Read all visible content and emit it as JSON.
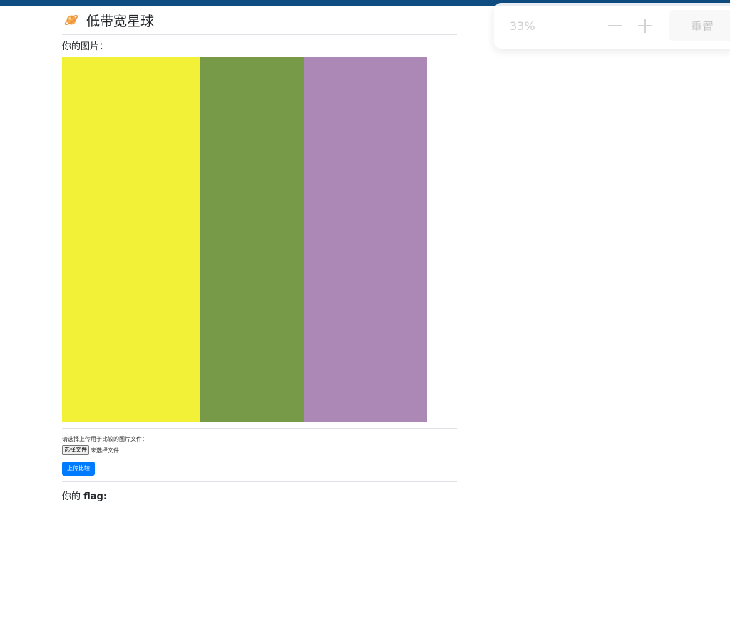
{
  "header": {
    "title": "低带宽星球",
    "icon": "planet-icon"
  },
  "image_section": {
    "label": "你的图片：",
    "stripes": [
      {
        "color": "#f3f137",
        "fraction": 0.379
      },
      {
        "color": "#769a47",
        "fraction": 0.285
      },
      {
        "color": "#ab88b6",
        "fraction": 0.336
      }
    ]
  },
  "upload": {
    "prompt": "请选择上传用于比较的图片文件：",
    "file_button_label": "选择文件",
    "no_file_text": "未选择文件",
    "submit_label": "上传比较"
  },
  "flag": {
    "prefix": "你的 ",
    "keyword": "flag:"
  },
  "zoom_toolbar": {
    "zoom_level": "33%",
    "zoom_out_icon": "minus-icon",
    "zoom_in_icon": "plus-icon",
    "reset_label": "重置"
  },
  "colors": {
    "accent": "#007bff",
    "top_strip": "#0f4c81"
  }
}
